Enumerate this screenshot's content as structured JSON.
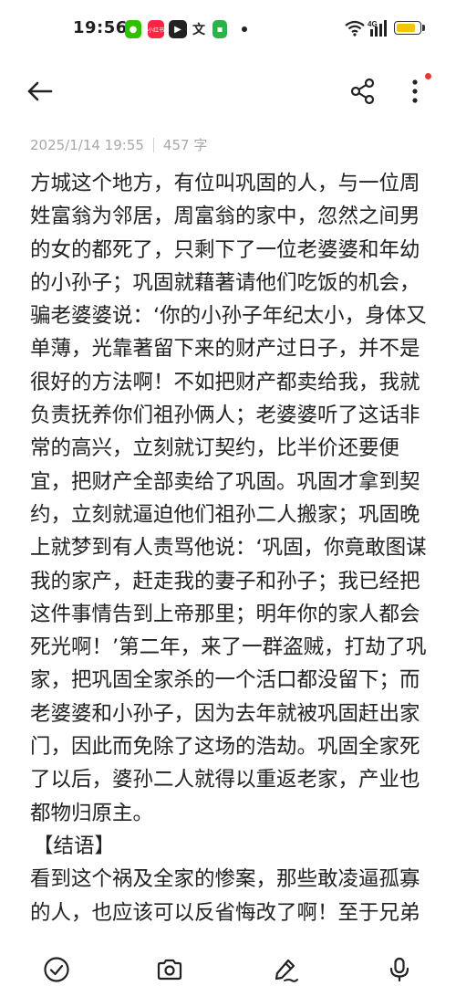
{
  "status_bar": {
    "time": "19:56",
    "xhs_label": "小红书",
    "wen_glyph": "文",
    "network_label": "4G",
    "battery_level": 0.85,
    "battery_color": "#f5c400"
  },
  "icons": {
    "back": "arrow-left-icon",
    "share": "share-icon",
    "more": "more-vertical-icon",
    "checklist": "check-circle-icon",
    "camera": "camera-icon",
    "handwrite": "pen-icon",
    "voice": "microphone-icon"
  },
  "note": {
    "date": "2025/1/14 19:55",
    "word_count": "457 字",
    "body": "方城这个地方，有位叫巩固的人，与一位周姓富翁为邻居，周富翁的家中，忽然之间男的女的都死了，只剩下了一位老婆婆和年幼的小孙子；巩固就藉著请他们吃饭的机会，骗老婆婆说：‘你的小孙子年纪太小，身体又单薄，光靠著留下来的财产过日子，并不是很好的方法啊！不如把财产都卖给我，我就负责抚养你们祖孙俩人；老婆婆听了这话非常的高兴，立刻就订契约，比半价还要便宜，把财产全部卖给了巩固。巩固才拿到契约，立刻就逼迫他们祖孙二人搬家；巩固晚上就梦到有人责骂他说：‘巩固，你竟敢图谋我的家产，赶走我的妻子和孙子；我已经把这件事情告到上帝那里；明年你的家人都会死光啊！’第二年，来了一群盗贼，打劫了巩家，把巩固全家杀的一个活口都没留下；而老婆婆和小孙子，因为去年就被巩固赶出家门，因此而免除了这场的浩劫。巩固全家死了以后，婆孙二人就得以重返老家，产业也都物归原主。",
    "section_heading": "【结语】",
    "conclusion": "看到这个祸及全家的惨案，那些敢凌逼孤寡的人，也应该可以反省悔改了啊！至于兄弟"
  }
}
